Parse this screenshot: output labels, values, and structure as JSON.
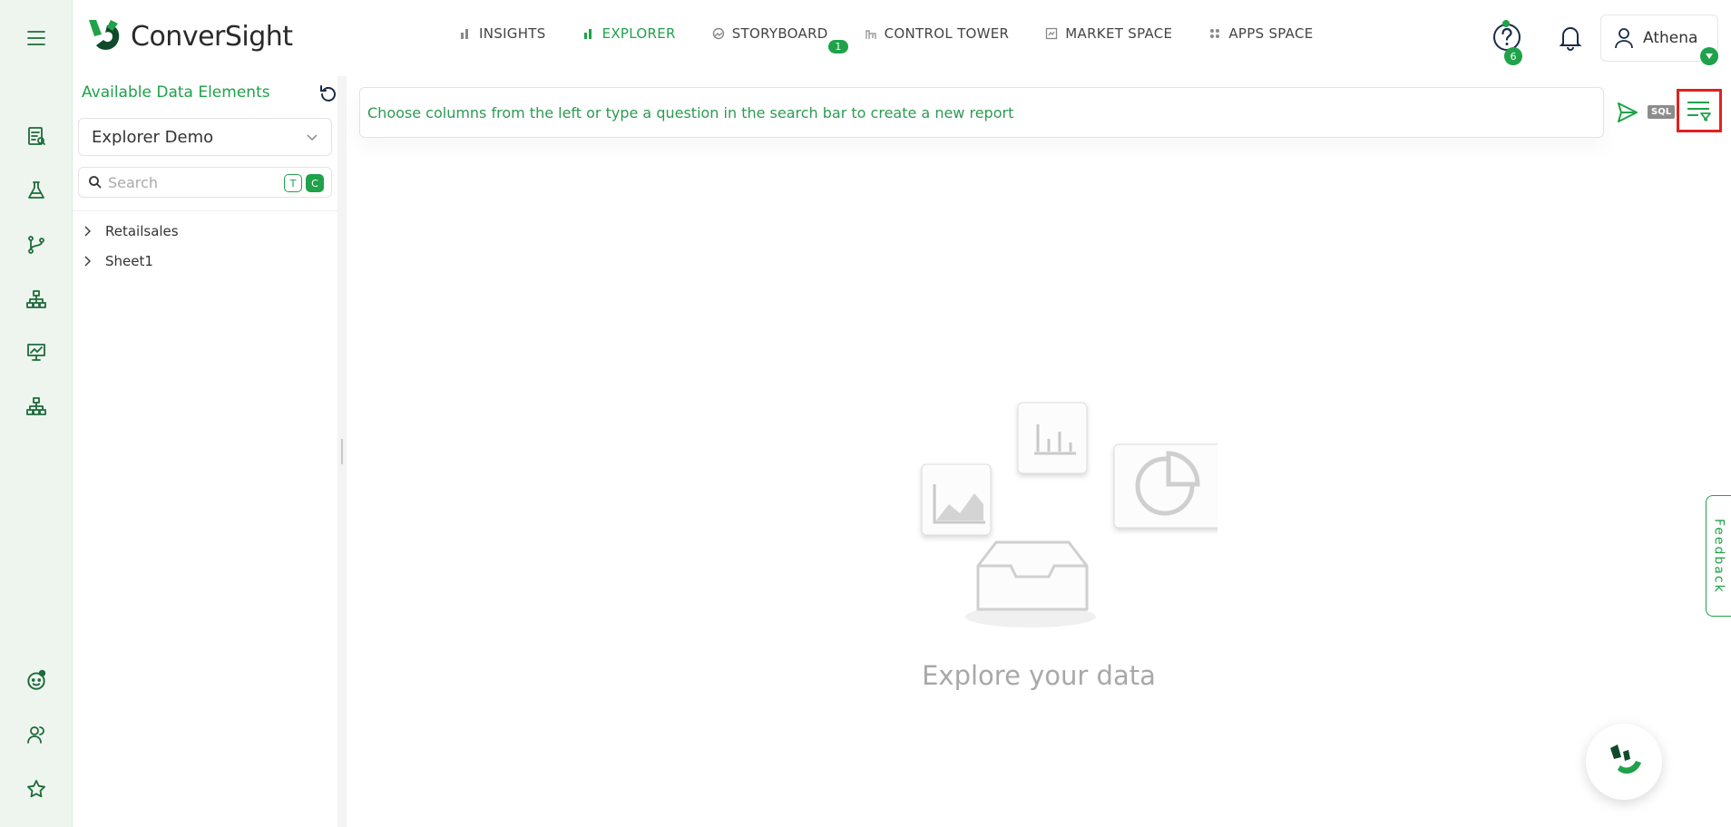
{
  "app": {
    "brand": "ConverSight",
    "brand_color": "#1fa24a"
  },
  "nav": {
    "items": [
      {
        "label": "INSIGHTS",
        "icon": "bar-chart-icon"
      },
      {
        "label": "EXPLORER",
        "icon": "bar-chart-icon",
        "active": true
      },
      {
        "label": "STORYBOARD",
        "icon": "storyboard-icon",
        "badge": "1"
      },
      {
        "label": "CONTROL TOWER",
        "icon": "control-tower-icon"
      },
      {
        "label": "MARKET SPACE",
        "icon": "market-space-icon"
      },
      {
        "label": "APPS SPACE",
        "icon": "apps-grid-icon"
      }
    ]
  },
  "header": {
    "notification_count": "6",
    "user_name": "Athena"
  },
  "panel": {
    "title": "Available Data Elements",
    "dataset": "Explorer Demo",
    "search_placeholder": "Search",
    "tag_t": "T",
    "tag_c": "C",
    "tree": [
      {
        "label": "Retailsales"
      },
      {
        "label": "Sheet1"
      }
    ]
  },
  "main": {
    "query_placeholder": "Choose columns from the left or type a question in the search bar to create a new report",
    "sql_label": "SQL",
    "empty_text": "Explore your data",
    "feedback_label": "Feedback"
  }
}
